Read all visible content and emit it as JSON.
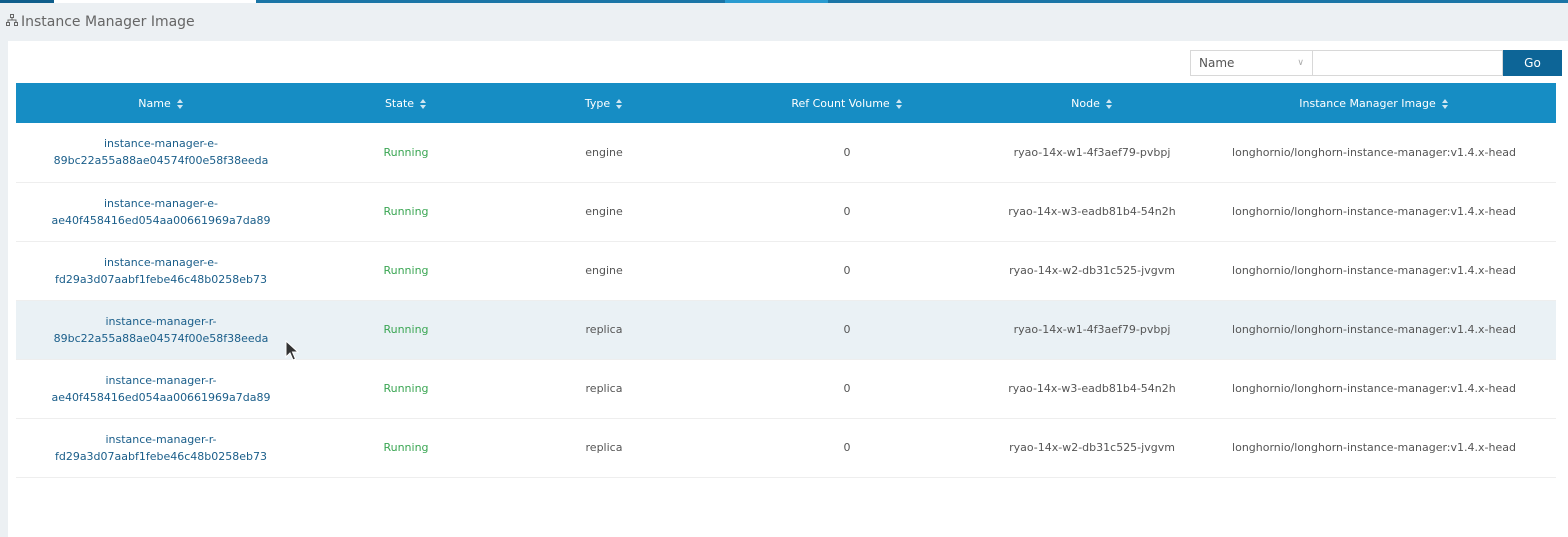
{
  "page": {
    "title": "Instance Manager Image"
  },
  "search": {
    "field_selected": "Name",
    "input_value": "",
    "input_placeholder": "",
    "go_label": "Go"
  },
  "table": {
    "headers": {
      "name": "Name",
      "state": "State",
      "type": "Type",
      "ref_count": "Ref Count Volume",
      "node": "Node",
      "image": "Instance Manager Image"
    },
    "rows": [
      {
        "name_line1": "instance-manager-e-",
        "name_line2": "89bc22a55a88ae04574f00e58f38eeda",
        "state": "Running",
        "type": "engine",
        "ref_count": "0",
        "node": "ryao-14x-w1-4f3aef79-pvbpj",
        "image": "longhornio/longhorn-instance-manager:v1.4.x-head"
      },
      {
        "name_line1": "instance-manager-e-",
        "name_line2": "ae40f458416ed054aa00661969a7da89",
        "state": "Running",
        "type": "engine",
        "ref_count": "0",
        "node": "ryao-14x-w3-eadb81b4-54n2h",
        "image": "longhornio/longhorn-instance-manager:v1.4.x-head"
      },
      {
        "name_line1": "instance-manager-e-",
        "name_line2": "fd29a3d07aabf1febe46c48b0258eb73",
        "state": "Running",
        "type": "engine",
        "ref_count": "0",
        "node": "ryao-14x-w2-db31c525-jvgvm",
        "image": "longhornio/longhorn-instance-manager:v1.4.x-head"
      },
      {
        "name_line1": "instance-manager-r-",
        "name_line2": "89bc22a55a88ae04574f00e58f38eeda",
        "state": "Running",
        "type": "replica",
        "ref_count": "0",
        "node": "ryao-14x-w1-4f3aef79-pvbpj",
        "image": "longhornio/longhorn-instance-manager:v1.4.x-head"
      },
      {
        "name_line1": "instance-manager-r-",
        "name_line2": "ae40f458416ed054aa00661969a7da89",
        "state": "Running",
        "type": "replica",
        "ref_count": "0",
        "node": "ryao-14x-w3-eadb81b4-54n2h",
        "image": "longhornio/longhorn-instance-manager:v1.4.x-head"
      },
      {
        "name_line1": "instance-manager-r-",
        "name_line2": "fd29a3d07aabf1febe46c48b0258eb73",
        "state": "Running",
        "type": "replica",
        "ref_count": "0",
        "node": "ryao-14x-w2-db31c525-jvgvm",
        "image": "longhornio/longhorn-instance-manager:v1.4.x-head"
      }
    ]
  },
  "colors": {
    "header_bg": "#168dc4",
    "running": "#3aa653",
    "link": "#1a5e8a",
    "go_button": "#0d6597"
  },
  "icons": {
    "page_icon": "sitemap-icon",
    "sort_icon": "sort-icon",
    "dropdown_icon": "chevron-down-icon"
  }
}
